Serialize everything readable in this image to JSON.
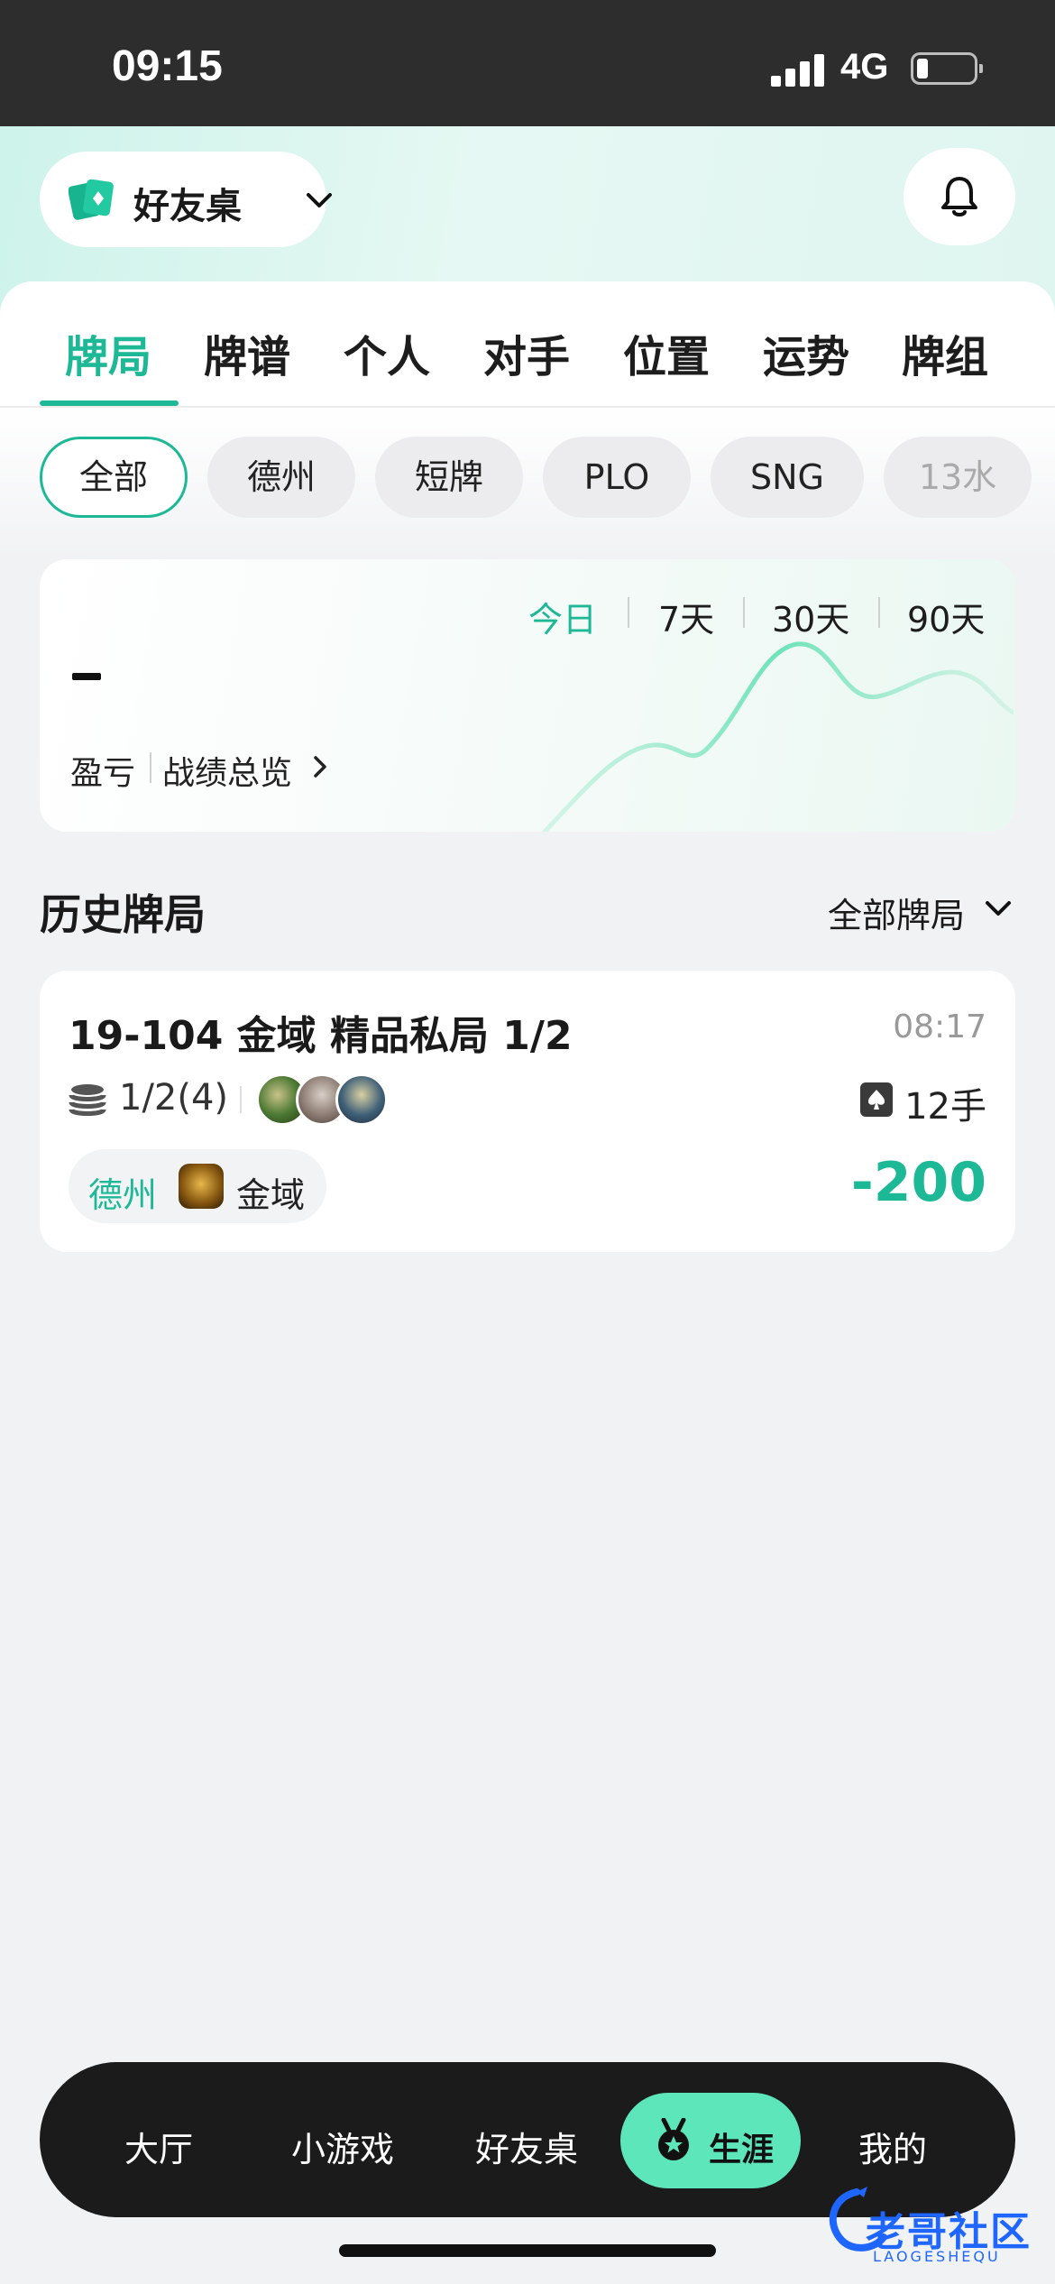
{
  "status_bar": {
    "time": "09:15",
    "network": "4G"
  },
  "header": {
    "table_selector_label": "好友桌"
  },
  "tabs": [
    {
      "label": "牌局",
      "active": true
    },
    {
      "label": "牌谱",
      "active": false
    },
    {
      "label": "个人",
      "active": false
    },
    {
      "label": "对手",
      "active": false
    },
    {
      "label": "位置",
      "active": false
    },
    {
      "label": "运势",
      "active": false
    },
    {
      "label": "牌组",
      "active": false
    }
  ],
  "filters": [
    {
      "label": "全部",
      "active": true
    },
    {
      "label": "德州",
      "active": false
    },
    {
      "label": "短牌",
      "active": false
    },
    {
      "label": "PLO",
      "active": false
    },
    {
      "label": "SNG",
      "active": false
    },
    {
      "label": "13水",
      "active": false
    }
  ],
  "stats": {
    "periods": [
      {
        "label": "今日",
        "active": true
      },
      {
        "label": "7天",
        "active": false
      },
      {
        "label": "30天",
        "active": false
      },
      {
        "label": "90天",
        "active": false
      }
    ],
    "value": "-",
    "label": "盈亏",
    "link": "战绩总览"
  },
  "history": {
    "title": "历史牌局",
    "filter": "全部牌局",
    "games": [
      {
        "title": "19-104 金域 精品私局 1/2",
        "time": "08:17",
        "blinds": "1/2(4)",
        "hands": "12手",
        "game_type": "德州",
        "club": "金域",
        "result": "-200"
      }
    ]
  },
  "bottom_nav": {
    "items": [
      "大厅",
      "小游戏",
      "好友桌",
      "生涯",
      "我的"
    ],
    "active": "生涯"
  },
  "watermark": {
    "text": "老哥社区",
    "sub": "LAOGESHEQU"
  },
  "colors": {
    "accent": "#1db895",
    "nav_active": "#5ee6bb",
    "nav_bg": "#1b1b1b"
  }
}
